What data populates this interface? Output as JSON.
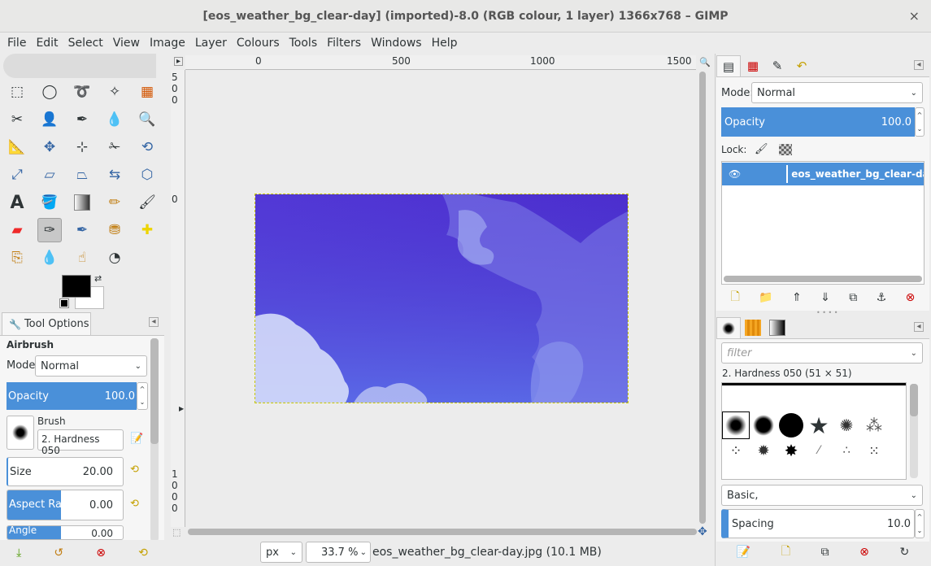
{
  "window": {
    "title": "[eos_weather_bg_clear-day] (imported)-8.0 (RGB colour, 1 layer) 1366x768 – GIMP",
    "close": "×"
  },
  "menubar": [
    "File",
    "Edit",
    "Select",
    "View",
    "Image",
    "Layer",
    "Colours",
    "Tools",
    "Filters",
    "Windows",
    "Help"
  ],
  "ruler": {
    "top": [
      "0",
      "500",
      "1000",
      "1500"
    ],
    "left_0": "500",
    "left_1": "0",
    "left_2": "1000"
  },
  "tooloptions": {
    "tab": "Tool Options",
    "tool": "Airbrush",
    "mode_label": "Mode:",
    "mode_value": "Normal",
    "opacity_label": "Opacity",
    "opacity_value": "100.0",
    "brush_label": "Brush",
    "brush_value": "2. Hardness 050",
    "size_label": "Size",
    "size_value": "20.00",
    "aspect_label": "Aspect Ratio",
    "aspect_value": "0.00",
    "angle_label": "Angle",
    "angle_value": "0.00"
  },
  "statusbar": {
    "unit": "px",
    "zoom": "33.7 %",
    "file": "eos_weather_bg_clear-day.jpg (10.1 MB)"
  },
  "layers": {
    "mode_label": "Mode:",
    "mode_value": "Normal",
    "opacity_label": "Opacity",
    "opacity_value": "100.0",
    "lock_label": "Lock:",
    "layer_name": "eos_weather_bg_clear-day"
  },
  "brushes": {
    "filter_placeholder": "filter",
    "current": "2. Hardness 050 (51 × 51)",
    "preset": "Basic,",
    "spacing_label": "Spacing",
    "spacing_value": "10.0"
  },
  "colors": {
    "accent": "#4a90d9",
    "image_top": "#4a2bd0",
    "image_bottom": "#5567e6"
  }
}
